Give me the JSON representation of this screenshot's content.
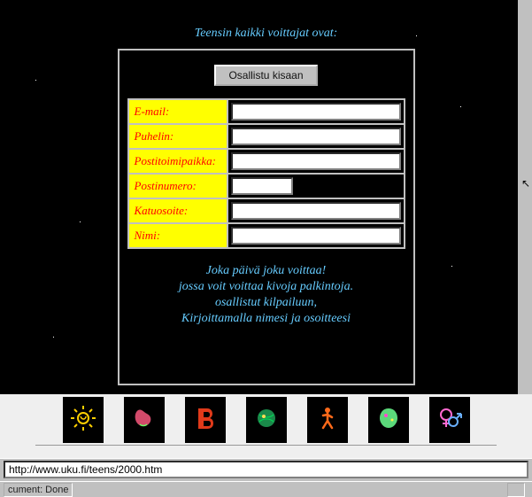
{
  "heading": "Teensin kaikki voittajat ovat:",
  "form": {
    "submit_label": "Osallistu kisaan",
    "fields": {
      "email": {
        "label": "E-mail:",
        "value": ""
      },
      "phone": {
        "label": "Puhelin:",
        "value": ""
      },
      "city": {
        "label": "Postitoimipaikka:",
        "value": ""
      },
      "zip": {
        "label": "Postinumero:",
        "value": ""
      },
      "street": {
        "label": "Katuosoite:",
        "value": ""
      },
      "name": {
        "label": "Nimi:",
        "value": ""
      }
    },
    "blurb": {
      "l1": "Joka päivä joku voittaa!",
      "l2": "jossa voit voittaa kivoja palkintoja.",
      "l3": "osallistut kilpailuun,",
      "l4": "Kirjoittamalla nimesi ja osoitteesi"
    }
  },
  "nav_icons": [
    "sun-icon",
    "bean-icon",
    "letter-b-icon",
    "planet-icon",
    "figure-icon",
    "orb-icon",
    "gender-icon"
  ],
  "address_bar": {
    "value": "http://www.uku.fi/teens/2000.htm"
  },
  "status": {
    "text": "cument: Done"
  }
}
